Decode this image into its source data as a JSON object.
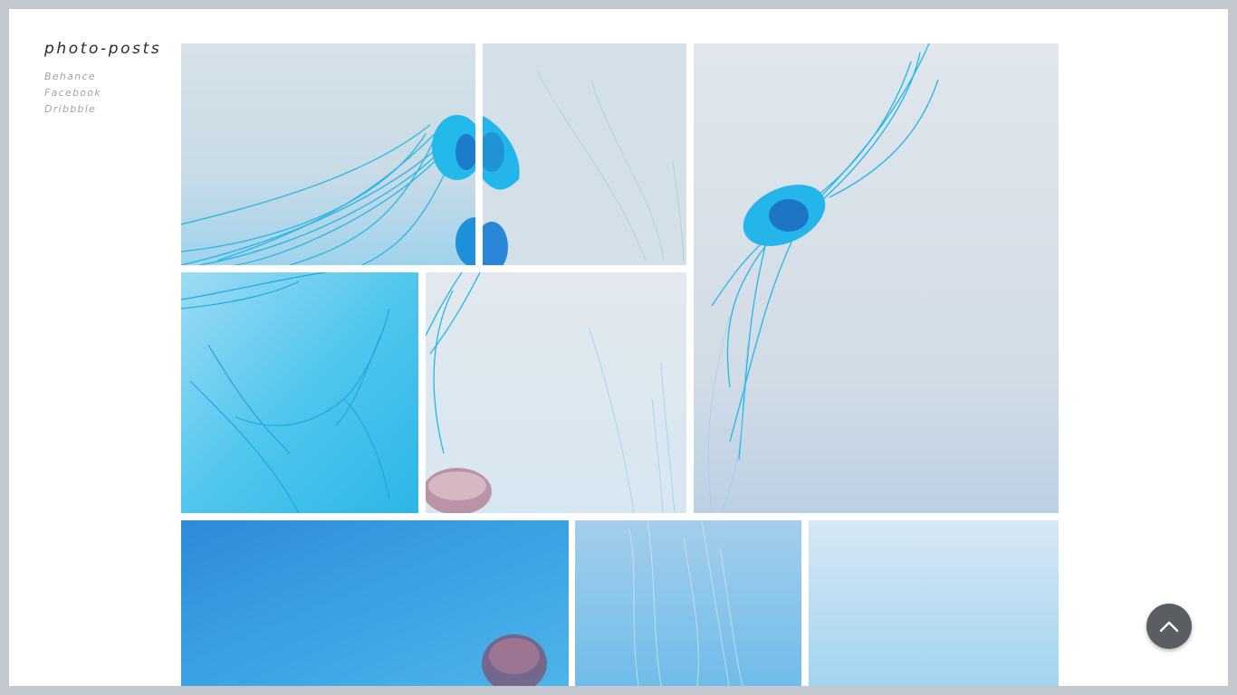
{
  "site": {
    "title": "photo-posts"
  },
  "social_links": [
    {
      "label": "Behance"
    },
    {
      "label": "Facebook"
    },
    {
      "label": "Dribbble"
    }
  ],
  "gallery": {
    "photo_count": 9,
    "subject": "jellyfish"
  },
  "colors": {
    "page_border": "#c3c8cf",
    "accent_blue": "#2bb6e6",
    "scroll_button": "#5a5d61"
  },
  "icons": {
    "scroll_top": "chevron-up-icon"
  }
}
